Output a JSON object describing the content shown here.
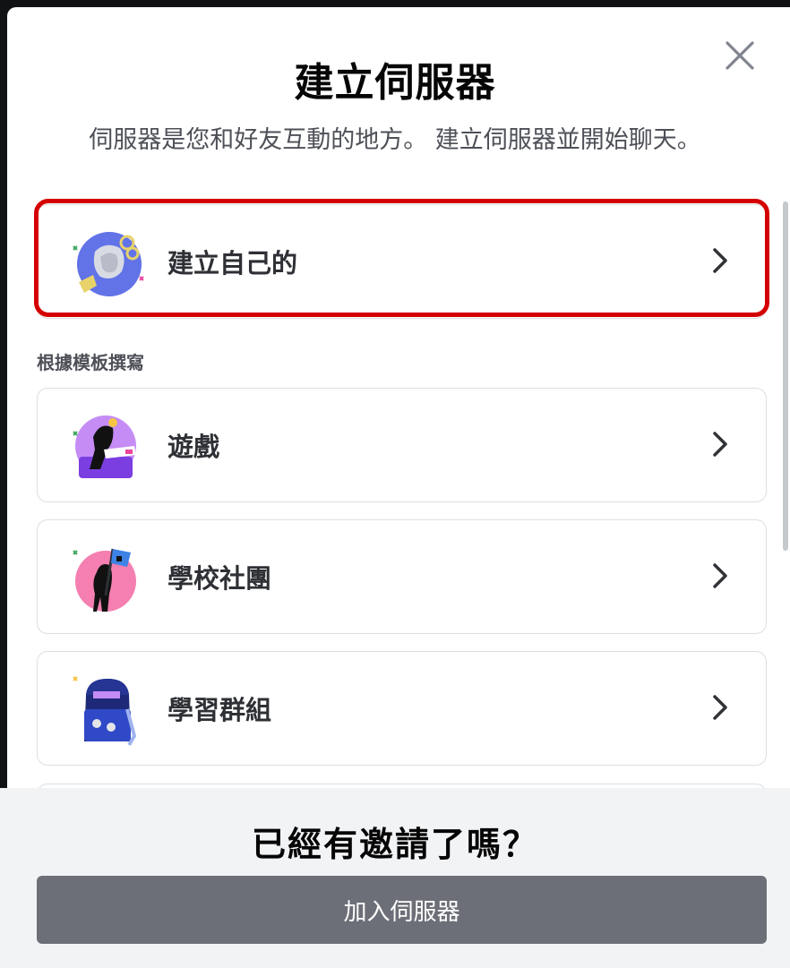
{
  "modal": {
    "title": "建立伺服器",
    "subtitle": "伺服器是您和好友互動的地方。 建立伺服器並開始聊天。",
    "close_icon": "close-icon"
  },
  "create_own": {
    "label": "建立自己的",
    "icon": "globe-hand-icon",
    "chevron": "chevron-right-icon"
  },
  "templates": {
    "header": "根據模板撰寫",
    "items": [
      {
        "label": "遊戲",
        "icon": "gaming-icon"
      },
      {
        "label": "學校社團",
        "icon": "school-club-icon"
      },
      {
        "label": "學習群組",
        "icon": "study-group-icon"
      }
    ]
  },
  "footer": {
    "title": "已經有邀請了嗎？",
    "join_label": "加入伺服器"
  },
  "colors": {
    "highlight": "#d40000",
    "join_button": "#6d6f78",
    "footer_bg": "#f2f3f5"
  }
}
